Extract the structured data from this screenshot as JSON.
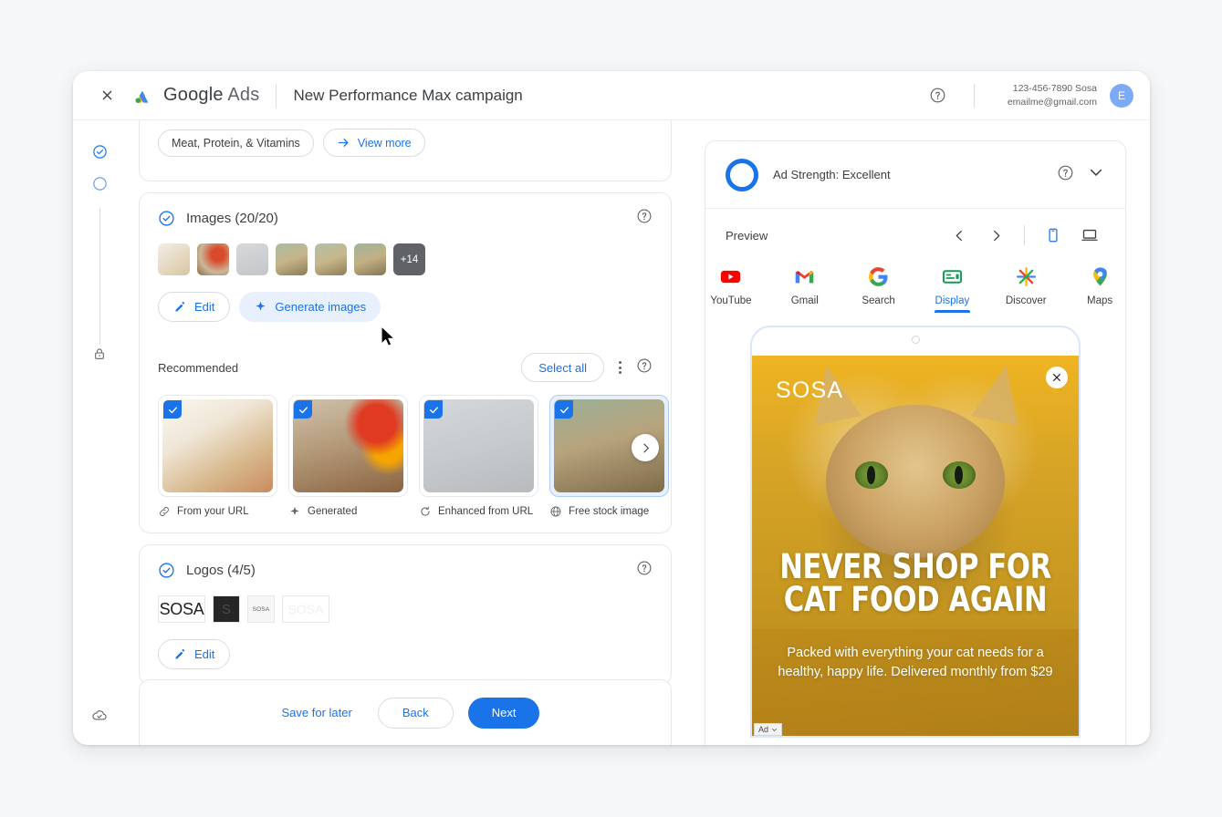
{
  "header": {
    "close_icon": "close-icon",
    "brand_google": "Google",
    "brand_ads": "Ads",
    "page_title": "New Performance Max campaign",
    "help_icon": "help-circle-icon",
    "account_id": "123-456-7890 Sosa",
    "account_email": "emailme@gmail.com",
    "avatar_initial": "E"
  },
  "rail": {
    "step_done_icon": "check-circle-icon",
    "step_current_icon": "circle-outline-icon",
    "lock_icon": "lock-icon",
    "cloud_icon": "cloud-done-icon"
  },
  "top_card": {
    "chip_label": "Meat, Protein, & Vitamins",
    "view_more_label": "View more",
    "arrow_icon": "arrow-right-icon"
  },
  "images_card": {
    "status_icon": "check-circle-icon",
    "title": "Images (20/20)",
    "help_icon": "help-circle-icon",
    "overflow_count": "+14",
    "edit_label": "Edit",
    "edit_icon": "pencil-icon",
    "generate_label": "Generate images",
    "generate_icon": "sparkle-icon",
    "thumbs": [
      {
        "name": "thumb-shelf-bag"
      },
      {
        "name": "thumb-cat-peppers"
      },
      {
        "name": "thumb-cans-stack"
      },
      {
        "name": "thumb-cat-bowl-1"
      },
      {
        "name": "thumb-cat-bowl-2"
      },
      {
        "name": "thumb-cat-bowl-3"
      }
    ]
  },
  "recommended": {
    "label": "Recommended",
    "select_all_label": "Select all",
    "kebab_icon": "more-vert-icon",
    "help_icon": "help-circle-icon",
    "next_icon": "chevron-right-icon",
    "items": [
      {
        "caption": "From your URL",
        "icon": "link-icon",
        "checked": true
      },
      {
        "caption": "Generated",
        "icon": "sparkle-icon",
        "checked": true
      },
      {
        "caption": "Enhanced from URL",
        "icon": "auto-enhance-icon",
        "checked": true
      },
      {
        "caption": "Free stock image",
        "icon": "globe-icon",
        "checked": true
      }
    ]
  },
  "logos_card": {
    "status_icon": "check-circle-icon",
    "title": "Logos (4/5)",
    "help_icon": "help-circle-icon",
    "edit_label": "Edit",
    "logos": [
      {
        "text": "SOSA",
        "variant": "light"
      },
      {
        "text": "S",
        "variant": "dark"
      },
      {
        "text": "SOSA",
        "variant": "small"
      },
      {
        "text": "SOSA",
        "variant": "faded"
      }
    ]
  },
  "footer": {
    "save_label": "Save for later",
    "back_label": "Back",
    "next_label": "Next"
  },
  "preview": {
    "ad_strength_label": "Ad Strength: Excellent",
    "help_icon": "help-circle-icon",
    "collapse_icon": "chevron-down-icon",
    "preview_label": "Preview",
    "prev_icon": "chevron-left-icon",
    "next_icon": "chevron-right-icon",
    "mobile_icon": "smartphone-icon",
    "desktop_icon": "laptop-icon",
    "active_device": "mobile",
    "tabs": [
      {
        "label": "YouTube",
        "icon": "youtube-icon",
        "active": false
      },
      {
        "label": "Gmail",
        "icon": "gmail-icon",
        "active": false
      },
      {
        "label": "Search",
        "icon": "google-g-icon",
        "active": false
      },
      {
        "label": "Display",
        "icon": "display-icon",
        "active": true
      },
      {
        "label": "Discover",
        "icon": "discover-icon",
        "active": false
      },
      {
        "label": "Maps",
        "icon": "maps-pin-icon",
        "active": false
      }
    ],
    "ad": {
      "brand": "SOSA",
      "close_icon": "close-icon",
      "headline_line1": "NEVER SHOP FOR",
      "headline_line2": "CAT FOOD AGAIN",
      "body": "Packed with everything your cat needs for a healthy, happy life. Delivered monthly from $29",
      "ad_badge": "Ad"
    }
  },
  "colors": {
    "accent": "#1a73e8",
    "tonal": "#e8f0fe",
    "text": "#3c4043",
    "muted": "#5f6368",
    "ad_gold": "#d99a14"
  }
}
